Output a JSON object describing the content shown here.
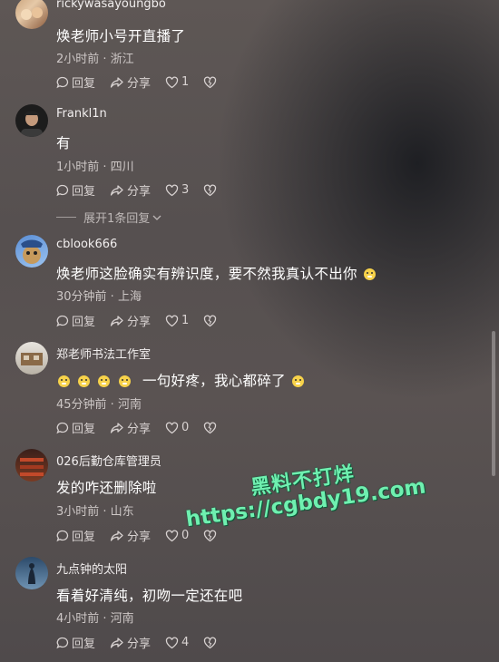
{
  "comments": [
    {
      "username": "rickywasayoungbo",
      "text": "焕老师小号开直播了",
      "meta": "2小时前 · 浙江",
      "reply_label": "回复",
      "share_label": "分享",
      "likes": "1"
    },
    {
      "username": "Frankl1n",
      "text": "有",
      "meta": "1小时前 · 四川",
      "reply_label": "回复",
      "share_label": "分享",
      "likes": "3"
    },
    {
      "username": "cblook666",
      "text": "焕老师这脸确实有辨识度，要不然我真认不出你",
      "meta": "30分钟前 · 上海",
      "reply_label": "回复",
      "share_label": "分享",
      "likes": "1"
    },
    {
      "username": "郑老师书法工作室",
      "text": "一句好疼，我心都碎了",
      "meta": "45分钟前 · 河南",
      "reply_label": "回复",
      "share_label": "分享",
      "likes": "0"
    },
    {
      "username": "026后勤仓库管理员",
      "text": "发的咋还删除啦",
      "meta": "3小时前 · 山东",
      "reply_label": "回复",
      "share_label": "分享",
      "likes": "0"
    },
    {
      "username": "九点钟的太阳",
      "text": "看着好清纯，初吻一定还在吧",
      "meta": "4小时前 · 河南",
      "reply_label": "回复",
      "share_label": "分享",
      "likes": "4"
    }
  ],
  "expand_replies": "展开1条回复",
  "watermark": {
    "line1": "黑料不打烊",
    "line2": "https://cgbdy19.com"
  },
  "colors": {
    "background": "#58514f",
    "watermark": "#6ff0b0"
  }
}
